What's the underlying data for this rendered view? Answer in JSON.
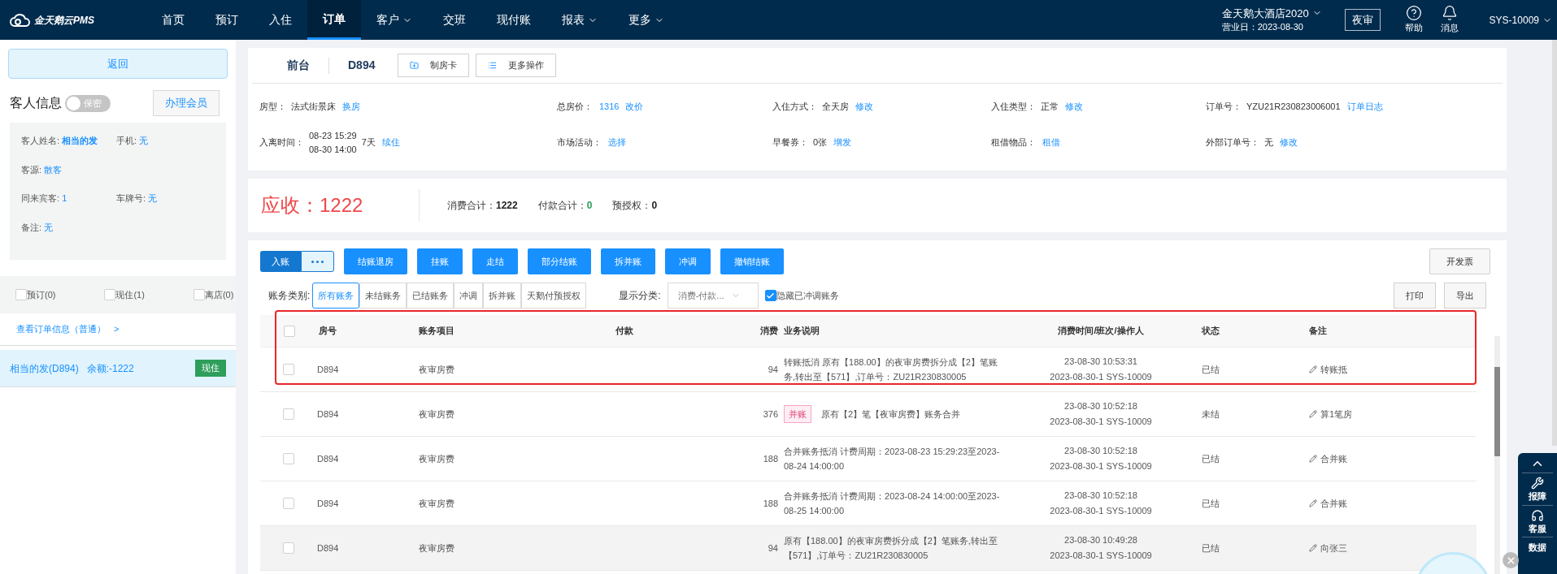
{
  "nav": {
    "logo": "金天鹅云PMS",
    "items": [
      {
        "label": "首页",
        "dropdown": false,
        "selected": false
      },
      {
        "label": "预订",
        "dropdown": false,
        "selected": false
      },
      {
        "label": "入住",
        "dropdown": false,
        "selected": false
      },
      {
        "label": "订单",
        "dropdown": false,
        "selected": true
      },
      {
        "label": "客户",
        "dropdown": true,
        "selected": false
      },
      {
        "label": "交班",
        "dropdown": false,
        "selected": false
      },
      {
        "label": "现付账",
        "dropdown": false,
        "selected": false
      },
      {
        "label": "报表",
        "dropdown": true,
        "selected": false
      },
      {
        "label": "更多",
        "dropdown": true,
        "selected": false
      }
    ],
    "hotel": "金天鹅大酒店2020",
    "business_day": "营业日：2023-08-30",
    "night_audit": "夜审",
    "help": "帮助",
    "messages": "消息",
    "user": "SYS-10009"
  },
  "sidebar": {
    "back": "返回",
    "guest_title": "客人信息",
    "privacy_toggle": {
      "label": "保密",
      "on": false
    },
    "member_button": "办理会员",
    "guest_fields": [
      [
        {
          "label": "客人姓名:",
          "value": "相当的发",
          "bold": true
        },
        {
          "label": "手机:",
          "value": "无",
          "bold": false
        }
      ],
      [
        {
          "label": "客源:",
          "value": "散客",
          "bold": false
        }
      ],
      [
        {
          "label": "同来宾客:",
          "value": "1",
          "bold": false
        },
        {
          "label": "车牌号:",
          "value": "无",
          "bold": false
        }
      ],
      [
        {
          "label": "备注:",
          "value": "无",
          "bold": false
        }
      ]
    ],
    "filters": [
      {
        "label": "预订(0)",
        "checked": false
      },
      {
        "label": "现住(1)",
        "checked": false
      },
      {
        "label": "离店(0)",
        "checked": false
      }
    ],
    "order_link": "查看订单信息（普通）",
    "order_link_arrow": ">",
    "guests": [
      {
        "name": "相当的发(D894)",
        "balance": "余额:-1222",
        "status": "现住",
        "selected": true
      }
    ]
  },
  "header": {
    "section": "前台",
    "room": "D894",
    "buttons": [
      {
        "kind": "card",
        "label": "制房卡"
      },
      {
        "kind": "list",
        "label": "更多操作"
      }
    ]
  },
  "info": [
    {
      "label": "房型：",
      "parts": [
        {
          "kind": "text",
          "text": "法式街景床"
        },
        {
          "kind": "link",
          "text": "换房"
        }
      ]
    },
    {
      "label": "总房价：",
      "parts": [
        {
          "kind": "link",
          "text": "1316"
        },
        {
          "kind": "link",
          "text": "改价"
        }
      ]
    },
    {
      "label": "入住方式：",
      "parts": [
        {
          "kind": "text",
          "text": "全天房"
        },
        {
          "kind": "link",
          "text": "修改"
        }
      ]
    },
    {
      "label": "入住类型：",
      "parts": [
        {
          "kind": "text",
          "text": "正常"
        },
        {
          "kind": "link",
          "text": "修改"
        }
      ]
    },
    {
      "label": "订单号：",
      "parts": [
        {
          "kind": "text",
          "text": "YZU21R230823006001"
        },
        {
          "kind": "link",
          "text": "订单日志"
        }
      ]
    },
    {
      "label": "入离时间：",
      "parts": [
        {
          "kind": "stack",
          "lines": [
            "08-23 15:29",
            "08-30 14:00"
          ]
        },
        {
          "kind": "text",
          "text": "7天"
        },
        {
          "kind": "link",
          "text": "续住"
        }
      ]
    },
    {
      "label": "市场活动：",
      "parts": [
        {
          "kind": "link",
          "text": "选择"
        }
      ]
    },
    {
      "label": "早餐券：",
      "parts": [
        {
          "kind": "text",
          "text": "0张"
        },
        {
          "kind": "link",
          "text": "增发"
        }
      ]
    },
    {
      "label": "租借物品：",
      "parts": [
        {
          "kind": "link",
          "text": "租借"
        }
      ]
    },
    {
      "label": "外部订单号：",
      "parts": [
        {
          "kind": "text",
          "text": "无"
        },
        {
          "kind": "link",
          "text": "修改"
        }
      ]
    }
  ],
  "summary": {
    "receivable": "应收：1222",
    "totals": [
      {
        "label": "消费合计：",
        "value": "1222",
        "kind": "plain"
      },
      {
        "label": "付款合计：",
        "value": "0",
        "kind": "positive"
      },
      {
        "label": "预授权：",
        "value": "0",
        "kind": "plain"
      }
    ]
  },
  "actions": {
    "post": "入账",
    "buttons": [
      "结账退房",
      "挂账",
      "走结",
      "部分结账",
      "拆并账",
      "冲调",
      "撤销结账"
    ],
    "invoice": "开发票"
  },
  "filter": {
    "label": "账务类别:",
    "tabs": [
      {
        "label": "所有账务",
        "selected": true
      },
      {
        "label": "未结账务",
        "selected": false
      },
      {
        "label": "已结账务",
        "selected": false
      },
      {
        "label": "冲调",
        "selected": false
      },
      {
        "label": "拆并账",
        "selected": false
      },
      {
        "label": "天鹅付预授权",
        "selected": false
      }
    ],
    "display_label": "显示分类:",
    "display_value": "消费-付款...",
    "hide_adjusted": {
      "label": "隐藏已冲调账务",
      "checked": true
    },
    "print": "打印",
    "export": "导出"
  },
  "table": {
    "highlight_frame": true,
    "header_checked": false,
    "columns": [
      "房号",
      "账务项目",
      "付款",
      "消费",
      "业务说明",
      "消费时间/班次/操作人",
      "状态",
      "备注"
    ],
    "rows": [
      {
        "room": "D894",
        "item": "夜审房费",
        "amount": "94",
        "tag": "",
        "desc": "转账抵消 原有【188.00】的夜审房费拆分成【2】笔账务,转出至【571】,订单号：ZU21R230830005",
        "time": "23-08-30 10:53:31",
        "shift": "2023-08-30-1 SYS-10009",
        "status": "已结",
        "note": "转账抵",
        "checked": false,
        "hovered": false
      },
      {
        "room": "D894",
        "item": "夜审房费",
        "amount": "376",
        "tag": "并账",
        "desc": "原有【2】笔【夜审房费】账务合并",
        "time": "23-08-30 10:52:18",
        "shift": "2023-08-30-1 SYS-10009",
        "status": "未结",
        "note": "算1笔房",
        "checked": false,
        "hovered": false
      },
      {
        "room": "D894",
        "item": "夜审房费",
        "amount": "188",
        "tag": "",
        "desc": "合并账务抵消 计费周期：2023-08-23 15:29:23至2023-08-24 14:00:00",
        "time": "23-08-30 10:52:18",
        "shift": "2023-08-30-1 SYS-10009",
        "status": "已结",
        "note": "合并账",
        "checked": false,
        "hovered": false
      },
      {
        "room": "D894",
        "item": "夜审房费",
        "amount": "188",
        "tag": "",
        "desc": "合并账务抵消 计费周期：2023-08-24 14:00:00至2023-08-25 14:00:00",
        "time": "23-08-30 10:52:18",
        "shift": "2023-08-30-1 SYS-10009",
        "status": "已结",
        "note": "合并账",
        "checked": false,
        "hovered": false
      },
      {
        "room": "D894",
        "item": "夜审房费",
        "amount": "94",
        "tag": "",
        "desc": "原有【188.00】的夜审房费拆分成【2】笔账务,转出至【571】,订单号：ZU21R230830005",
        "time": "23-08-30 10:49:28",
        "shift": "2023-08-30-1 SYS-10009",
        "status": "已结",
        "note": "向张三",
        "checked": false,
        "hovered": true
      }
    ]
  },
  "float_bar": [
    {
      "kind": "wrench",
      "label": "报障"
    },
    {
      "kind": "headset",
      "label": "客服"
    },
    {
      "kind": "data",
      "label": "数据"
    }
  ]
}
